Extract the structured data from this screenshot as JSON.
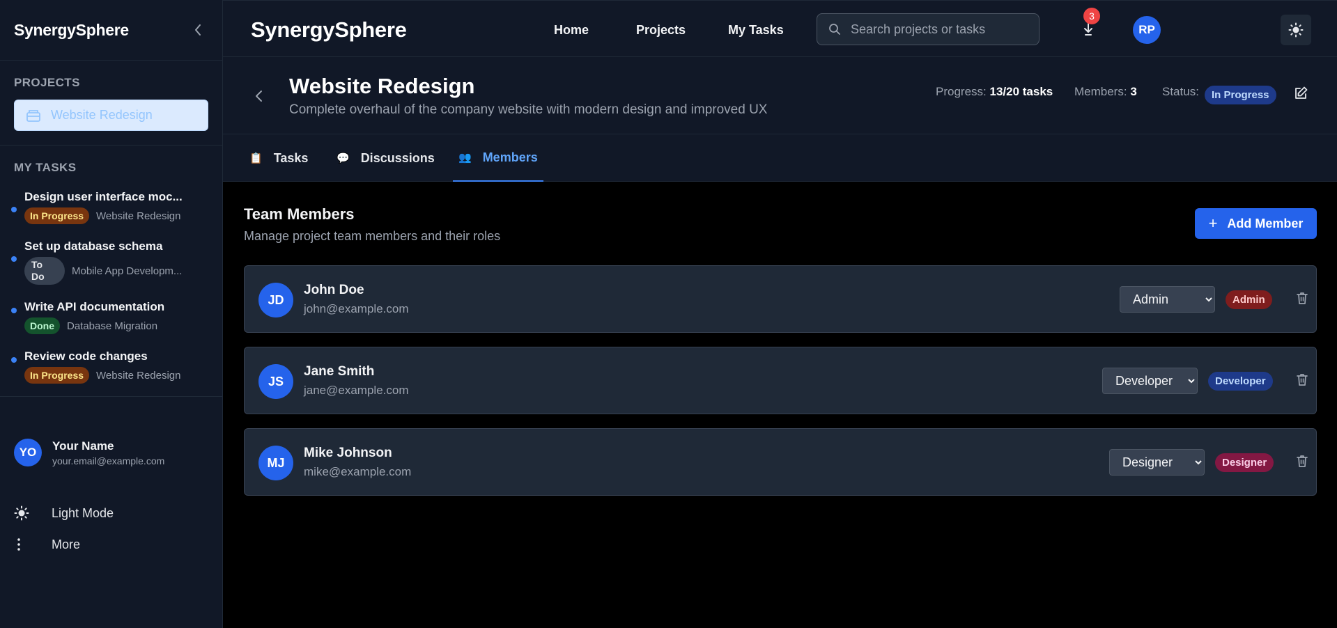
{
  "sidebar": {
    "brand": "SynergySphere",
    "projects_title": "PROJECTS",
    "projects": [
      {
        "label": "Website Redesign"
      }
    ],
    "tasks_title": "MY TASKS",
    "tasks": [
      {
        "title": "Design user interface moc...",
        "status": "In Progress",
        "project": "Website Redesign"
      },
      {
        "title": "Set up database schema",
        "status": "To Do",
        "project": "Mobile App Developm..."
      },
      {
        "title": "Write API documentation",
        "status": "Done",
        "project": "Database Migration"
      },
      {
        "title": "Review code changes",
        "status": "In Progress",
        "project": "Website Redesign"
      }
    ],
    "user": {
      "initials": "YO",
      "name": "Your Name",
      "email": "your.email@example.com"
    },
    "light_mode_label": "Light Mode",
    "more_label": "More"
  },
  "topbar": {
    "brand": "SynergySphere",
    "nav": [
      "Home",
      "Projects",
      "My Tasks"
    ],
    "search_placeholder": "Search projects or tasks",
    "notification_count": "3",
    "avatar_initials": "RP"
  },
  "project": {
    "title": "Website Redesign",
    "description": "Complete overhaul of the company website with modern design and improved UX",
    "progress_label": "Progress:",
    "progress_value": "13/20 tasks",
    "members_label": "Members:",
    "members_value": "3",
    "status_label": "Status:",
    "status_value": "In Progress"
  },
  "tabs": [
    {
      "label": "Tasks",
      "icon": "clipboard-icon"
    },
    {
      "label": "Discussions",
      "icon": "speech-bubble-icon"
    },
    {
      "label": "Members",
      "icon": "people-icon",
      "active": true
    }
  ],
  "members_section": {
    "title": "Team Members",
    "subtitle": "Manage project team members and their roles",
    "add_label": "Add Member",
    "members": [
      {
        "initials": "JD",
        "name": "John Doe",
        "email": "john@example.com",
        "role": "Admin"
      },
      {
        "initials": "JS",
        "name": "Jane Smith",
        "email": "jane@example.com",
        "role": "Developer"
      },
      {
        "initials": "MJ",
        "name": "Mike Johnson",
        "email": "mike@example.com",
        "role": "Designer"
      }
    ]
  },
  "colors": {
    "accent": "#2563eb",
    "background": "#000000",
    "panel": "#111827",
    "card": "#1f2937"
  }
}
